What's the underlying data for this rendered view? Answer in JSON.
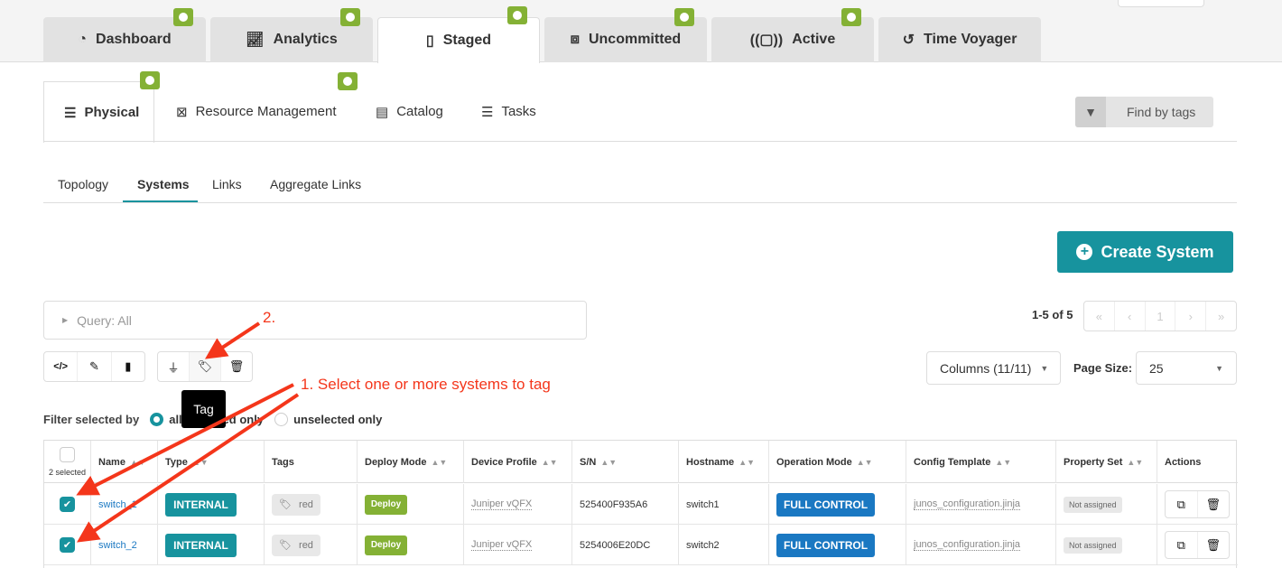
{
  "top_tabs": [
    {
      "label": "Dashboard",
      "icon": "gauge-icon",
      "status": "ok"
    },
    {
      "label": "Analytics",
      "icon": "line-chart-icon",
      "status": "ok"
    },
    {
      "label": "Staged",
      "icon": "staged-file-icon",
      "status": "ok",
      "active": true
    },
    {
      "label": "Uncommitted",
      "icon": "uncommitted-icon",
      "status": "ok"
    },
    {
      "label": "Active",
      "icon": "active-signal-icon",
      "status": "ok"
    },
    {
      "label": "Time Voyager",
      "icon": "history-icon"
    }
  ],
  "sub_tabs": [
    {
      "label": "Physical",
      "icon": "server-icon",
      "status": "ok",
      "active": true
    },
    {
      "label": "Resource Management",
      "icon": "resource-icon",
      "status": "ok"
    },
    {
      "label": "Catalog",
      "icon": "catalog-icon"
    },
    {
      "label": "Tasks",
      "icon": "list-icon"
    }
  ],
  "find_by_tags": "Find by tags",
  "view_tabs": [
    "Topology",
    "Systems",
    "Links",
    "Aggregate Links"
  ],
  "active_view_tab": "Systems",
  "create_system": "Create System",
  "query": "Query: All",
  "pagination": {
    "range": "1-5 of 5",
    "page": "1",
    "first": "«",
    "prev": "‹",
    "next": "›",
    "last": "»"
  },
  "columns_select": "Columns (11/11)",
  "page_size_label": "Page Size:",
  "page_size": "25",
  "tooltip": "Tag",
  "filter": {
    "label": "Filter selected by",
    "options": [
      "all",
      "selected only",
      "unselected only"
    ],
    "selected": "all"
  },
  "table": {
    "selected_count": "2 selected",
    "columns": [
      "Name",
      "Type",
      "Tags",
      "Deploy Mode",
      "Device Profile",
      "S/N",
      "Hostname",
      "Operation Mode",
      "Config Template",
      "Property Set",
      "Actions"
    ],
    "rows": [
      {
        "checked": true,
        "name": "switch_1",
        "type": "INTERNAL",
        "tag": "red",
        "deploy": "Deploy",
        "profile": "Juniper vQFX",
        "sn": "525400F935A6",
        "hostname": "switch1",
        "op_mode": "FULL CONTROL",
        "config": "junos_configuration.jinja",
        "property_set": "Not assigned"
      },
      {
        "checked": true,
        "name": "switch_2",
        "type": "INTERNAL",
        "tag": "red",
        "deploy": "Deploy",
        "profile": "Juniper vQFX",
        "sn": "5254006E20DC",
        "hostname": "switch2",
        "op_mode": "FULL CONTROL",
        "config": "junos_configuration.jinja",
        "property_set": "Not assigned"
      }
    ]
  },
  "annotations": {
    "step1": "1. Select one or more systems to tag",
    "step2": "2."
  },
  "colors": {
    "accent": "#17939e",
    "ok": "#84b135",
    "op_mode": "#1a78c2",
    "annotation": "#f4361b"
  }
}
